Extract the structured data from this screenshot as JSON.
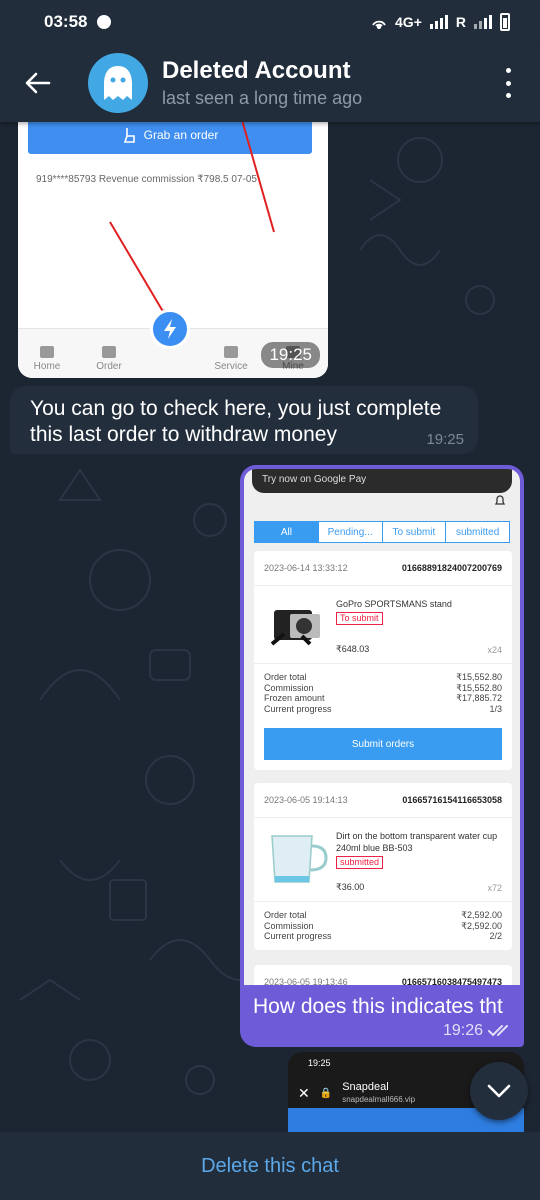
{
  "status_bar": {
    "time": "03:58",
    "network": "4G+",
    "roaming": "R"
  },
  "header": {
    "name": "Deleted Account",
    "status": "last seen a long time ago"
  },
  "messages": {
    "image1": {
      "grab_button": "Grab an order",
      "record": "919****85793   Revenue commission ₹798.5    07-05",
      "nav": [
        "Home",
        "Order",
        "Service",
        "Mine"
      ],
      "time": "19:25"
    },
    "incoming": {
      "text": "You can go to check here, you just complete this last order to withdraw money",
      "time": "19:25"
    },
    "outgoing": {
      "banner": "Try now on Google Pay",
      "tabs": [
        "All",
        "Pending...",
        "To submit",
        "submitted"
      ],
      "orders": [
        {
          "date": "2023-06-14 13:33:12",
          "id": "01668891824007200769",
          "product": "GoPro SPORTSMANS stand",
          "badge": "To submit",
          "price": "₹648.03",
          "qty": "x24",
          "summary": [
            {
              "label": "Order total",
              "value": "₹15,552.80"
            },
            {
              "label": "Commission",
              "value": "₹15,552.80"
            },
            {
              "label": "Frozen amount",
              "value": "₹17,885.72"
            },
            {
              "label": "Current progress",
              "value": "1/3"
            }
          ],
          "button": "Submit orders"
        },
        {
          "date": "2023-06-05 19:14:13",
          "id": "01665716154116653058",
          "product": "Dirt on the bottom transparent water cup 240ml blue BB-503",
          "badge": "submitted",
          "price": "₹36.00",
          "qty": "x72",
          "summary": [
            {
              "label": "Order total",
              "value": "₹2,592.00"
            },
            {
              "label": "Commission",
              "value": "₹2,592.00"
            },
            {
              "label": "Current progress",
              "value": "2/2"
            }
          ]
        },
        {
          "date": "2023-06-05 19:13:46",
          "id": "01665716038475497473"
        }
      ],
      "caption": "How does this indicates tht",
      "time": "19:26"
    },
    "image3": {
      "time": "19:25",
      "site_name": "Snapdeal",
      "site_url": "snapdealmall666.vip"
    }
  },
  "bottom": {
    "delete_label": "Delete this chat"
  },
  "colors": {
    "accent": "#5ca8e8",
    "outgoing_bubble": "#6e5bd7",
    "header_bg": "#212d3b",
    "chat_bg": "#1c2532"
  }
}
